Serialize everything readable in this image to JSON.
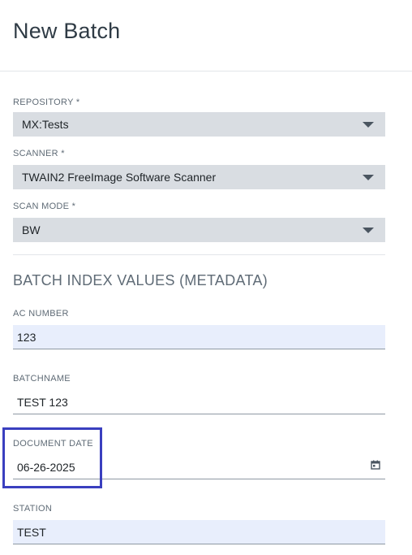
{
  "header": {
    "title": "New Batch"
  },
  "form": {
    "repository": {
      "label": "REPOSITORY *",
      "value": "MX:Tests",
      "icon": "chevron-down-icon"
    },
    "scanner": {
      "label": "SCANNER *",
      "value": "TWAIN2 FreeImage Software Scanner",
      "icon": "chevron-down-icon"
    },
    "scan_mode": {
      "label": "SCAN MODE *",
      "value": "BW",
      "icon": "chevron-down-icon"
    }
  },
  "metadata": {
    "section_title": "BATCH INDEX VALUES (METADATA)",
    "ac_number": {
      "label": "AC NUMBER",
      "value": "123"
    },
    "batchname": {
      "label": "BATCHNAME",
      "value": "TEST 123"
    },
    "document_date": {
      "label": "DOCUMENT DATE",
      "value": "06-26-2025",
      "icon": "calendar-icon"
    },
    "station": {
      "label": "STATION",
      "value": "TEST"
    }
  },
  "colors": {
    "select_bg": "#d9dde2",
    "filled_input_bg": "#e8eefc",
    "highlight_border": "#3a3fbf",
    "label_text": "#5f6b76"
  }
}
